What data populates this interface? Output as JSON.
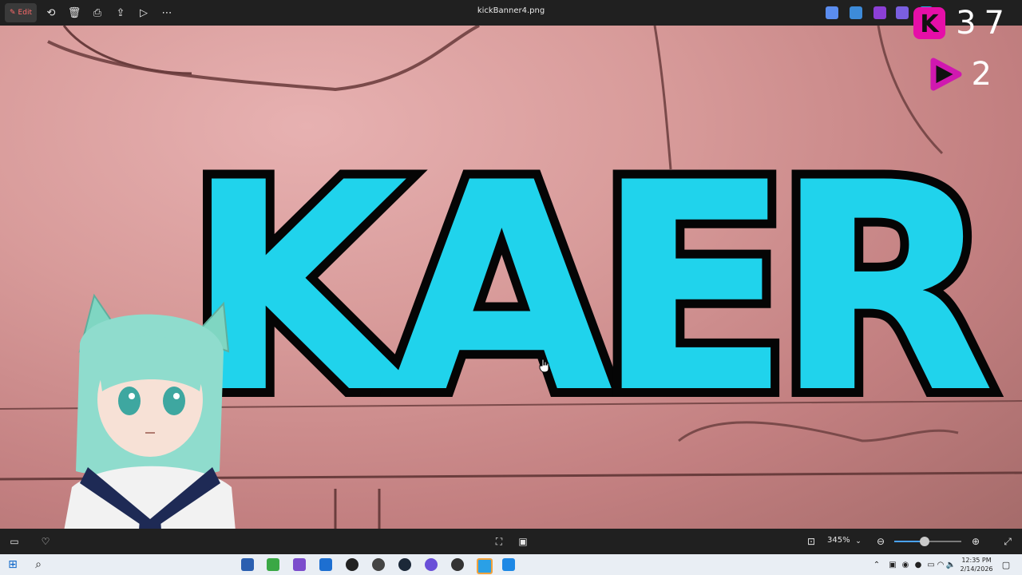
{
  "toolbar": {
    "edit_label": "Edit",
    "file_name": "kickBanner4.png",
    "icons": [
      "rotate-icon",
      "delete-icon",
      "print-icon",
      "share-icon",
      "slideshow-icon",
      "more-icon"
    ]
  },
  "canvas": {
    "banner_text": "KAER"
  },
  "overlay": {
    "followers_count": "37",
    "viewers_count": "2",
    "brand_color": "#e60fa8"
  },
  "bottombar": {
    "zoom_label": "345%",
    "zoom_slider_fraction": 0.45
  },
  "taskbar": {
    "time": "12:35 PM",
    "date": "2/14/2026"
  }
}
